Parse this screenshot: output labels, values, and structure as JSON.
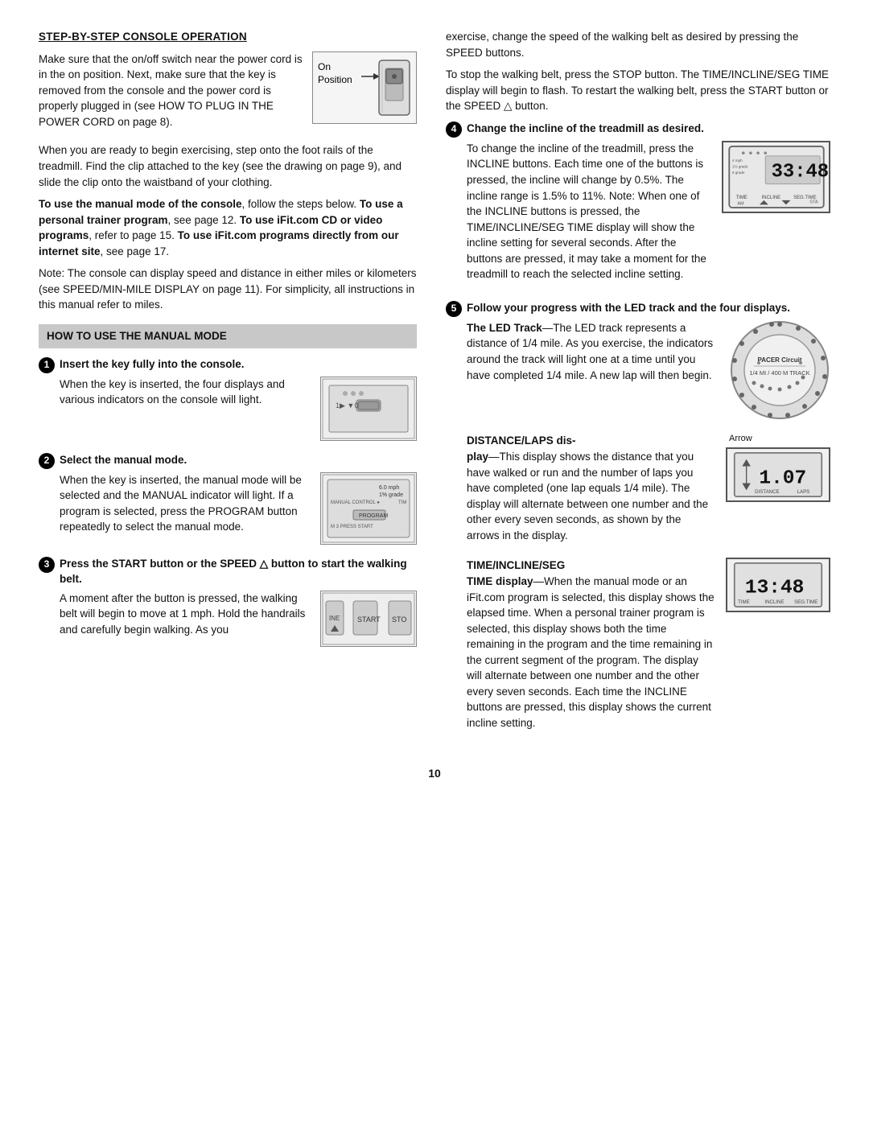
{
  "page": {
    "number": "10"
  },
  "left_col": {
    "section_title": "STEP-BY-STEP CONSOLE OPERATION",
    "intro_paragraphs": [
      "Make sure that the on/off switch near the power cord is in the on position. Next, make sure that the key is removed from the console and the power cord is properly plugged in (see HOW TO PLUG IN THE POWER CORD on page 8).",
      "When you are ready to begin exercising, step onto the foot rails of the treadmill. Find the clip attached to the key (see the drawing on page 9), and slide the clip onto the waistband of your clothing."
    ],
    "bold_paragraph": "To use the manual mode of the console, follow the steps below. To use a personal trainer program, see page 12. To use iFit.com CD or video programs, refer to page 15. To use iFit.com programs directly from our internet site, see page 17.",
    "note_paragraph": "Note: The console can display speed and distance in either miles or kilometers (see SPEED/MIN-MILE DISPLAY on page 11). For simplicity, all instructions in this manual refer to miles.",
    "manual_mode_bar": "HOW TO USE THE MANUAL MODE",
    "steps": [
      {
        "num": "1",
        "title": "Insert the key fully into the console.",
        "body": "When the key is inserted, the four displays and various indicators on the console will light."
      },
      {
        "num": "2",
        "title": "Select the manual mode.",
        "body": "When the key is inserted, the manual mode will be selected and the MANUAL indicator will light. If a program is selected, press the PROGRAM button repeatedly to select the manual mode."
      },
      {
        "num": "3",
        "title": "Press the START button or the SPEED △ button to start the walking belt.",
        "body": "A moment after the button is pressed, the walking belt will begin to move at 1 mph. Hold the handrails and carefully begin walking. As you"
      }
    ],
    "on_position_label": "On\nPosition"
  },
  "right_col": {
    "intro_paragraphs": [
      "exercise, change the speed of the walking belt as desired by pressing the SPEED buttons.",
      "To stop the walking belt, press the STOP button. The TIME/INCLINE/SEG TIME display will begin to flash. To restart the walking belt, press the START button or the SPEED △ button."
    ],
    "step4": {
      "num": "4",
      "title": "Change the incline of the treadmill as desired.",
      "body": "To change the incline of the treadmill, press the INCLINE buttons. Each time one of the buttons is pressed, the incline will change by 0.5%. The incline range is 1.5% to 11%. Note: When one of the INCLINE buttons is pressed, the TIME/INCLINE/SEG TIME display will show the incline setting for several seconds. After the buttons are pressed, it may take a moment for the treadmill to reach the selected incline setting.",
      "display_digits": "33:48",
      "display_labels": [
        "TIME",
        "INCLINE",
        "SEG.TIME"
      ]
    },
    "step5": {
      "num": "5",
      "title": "Follow your progress with the LED track and the four displays.",
      "subsections": [
        {
          "id": "led_track",
          "bold_title": "The LED Track",
          "dash": "—",
          "body": "The LED track represents a distance of 1/4 mile. As you exercise, the indicators around the track will light one at a time until you have completed 1/4 mile. A new lap will then begin.",
          "led_inner_text": "PACER Circuit\n1/4 MI / 400 M TRACK"
        },
        {
          "id": "distance_laps",
          "bold_title": "DISTANCE/LAPS dis-",
          "body_prefix": "play",
          "dash": "—",
          "body": "This display shows the distance that you have walked or run and the number of laps you have completed (one lap equals 1/4 mile). The display will alternate between one number and the other every seven seconds, as shown by the arrows in the display.",
          "display_digits": "1.07",
          "display_labels": [
            "DISTANCE",
            "LAPS"
          ],
          "arrow_label": "Arrow"
        },
        {
          "id": "time_incline_seg",
          "bold_title": "TIME/INCLINE/SEG",
          "body_prefix": "TIME display",
          "dash": "—",
          "body": "When the manual mode or an iFit.com program is selected, this display shows the elapsed time. When a personal trainer program is selected, this display shows both the time remaining in the program and the time remaining in the current segment of the program. The display will alternate between one number and the other every seven seconds. Each time the INCLINE buttons are pressed, this display shows the current incline setting.",
          "display_digits": "13:48",
          "display_labels": [
            "TIME",
            "INCLINE",
            "SEG.TIME"
          ]
        }
      ]
    }
  }
}
